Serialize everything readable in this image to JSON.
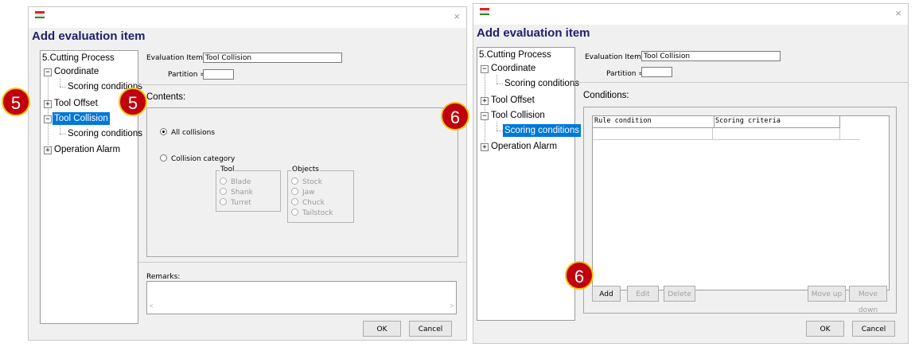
{
  "left_dialog": {
    "title": "Add evaluation item",
    "tree": {
      "root": "5.Cutting Process",
      "items": [
        "Coordinate",
        "Scoring conditions",
        "Tool Offset",
        "Tool Collision",
        "Scoring conditions",
        "Operation Alarm"
      ]
    },
    "evaluation_item_label": "Evaluation Item =",
    "evaluation_item_value": "Tool Collision",
    "partition_label": "Partition =",
    "contents_title": "Contents:",
    "options": {
      "all_collisions": "All collisions",
      "collision_category": "Collision category",
      "tool_group": "Tool",
      "tool_options": [
        "Blade",
        "Shank",
        "Turret"
      ],
      "objects_group": "Objects",
      "objects_options": [
        "Stock",
        "Jaw",
        "Chuck",
        "Tailstock"
      ]
    },
    "remarks_title": "Remarks:",
    "scroll_left": "<",
    "scroll_right": ">",
    "ok": "OK",
    "cancel": "Cancel",
    "close": "×"
  },
  "right_dialog": {
    "title": "Add evaluation item",
    "tree": {
      "root": "5.Cutting Process",
      "items": [
        "Coordinate",
        "Scoring conditions",
        "Tool Offset",
        "Tool Collision",
        "Scoring conditions",
        "Operation Alarm"
      ]
    },
    "evaluation_item_label": "Evaluation Item =",
    "evaluation_item_value": "Tool Collision",
    "partition_label": "Partition =",
    "conditions_title": "Conditions:",
    "columns": [
      "Rule condition",
      "Scoring criteria"
    ],
    "buttons": {
      "add": "Add",
      "edit": "Edit",
      "delete": "Delete",
      "move_up": "Move up",
      "move_down": "Move down"
    },
    "ok": "OK",
    "cancel": "Cancel",
    "close": "×"
  },
  "badges": [
    "5",
    "5",
    "6",
    "6"
  ],
  "colors": {
    "badge_fill": "#c0000d",
    "badge_border": "#f1c40f",
    "selection": "#0078d7",
    "title_text": "#1f1f6e"
  }
}
